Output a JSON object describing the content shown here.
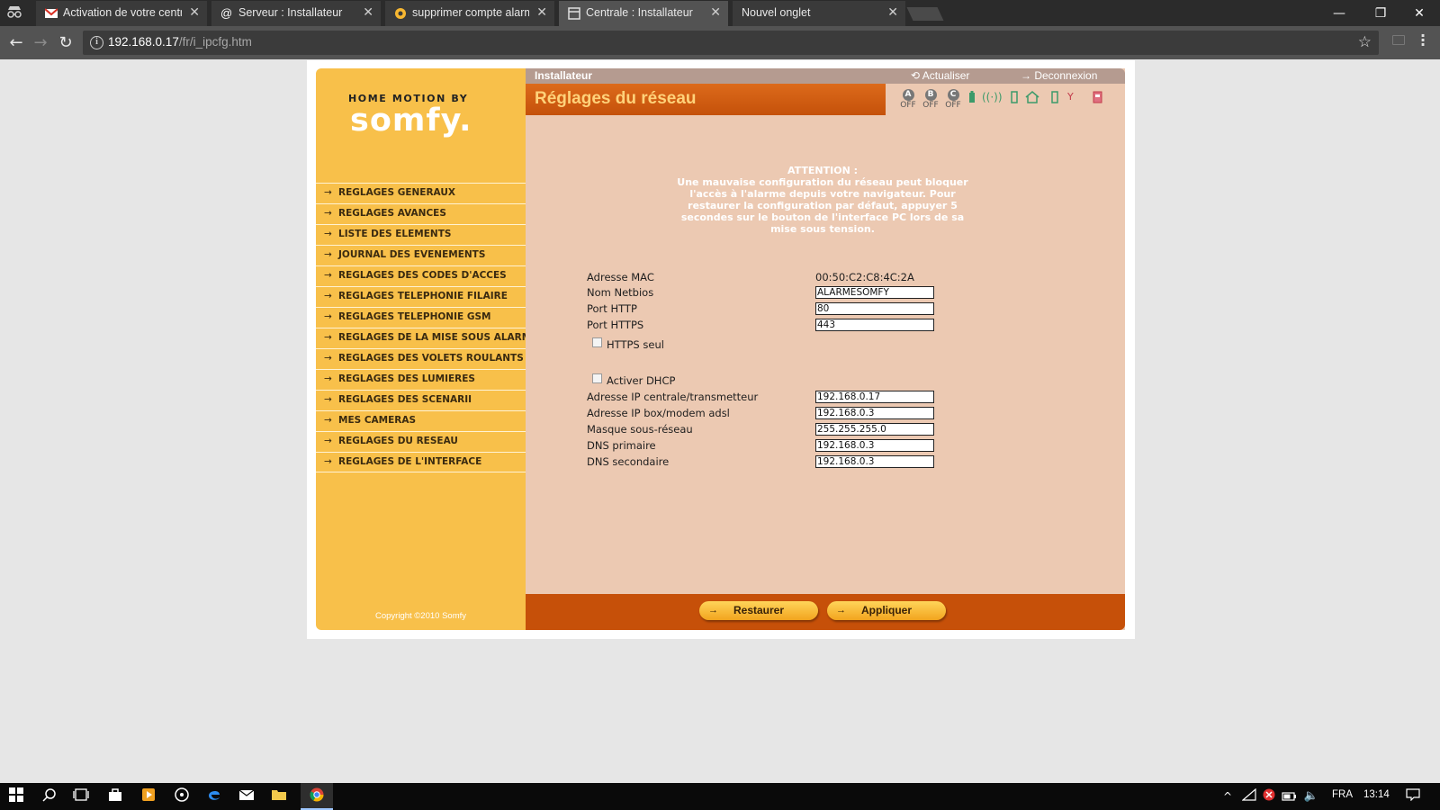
{
  "browser": {
    "tabs": [
      {
        "title": "Activation de votre centr",
        "icon": "gmail-icon"
      },
      {
        "title": "Serveur : Installateur",
        "icon": "at-icon"
      },
      {
        "title": "supprimer compte alarm",
        "icon": "circle-icon"
      },
      {
        "title": "Centrale : Installateur",
        "icon": "page-icon"
      },
      {
        "title": "Nouvel onglet",
        "icon": ""
      }
    ],
    "active_tab": 3,
    "url_host": "192.168.0.17",
    "url_path": "/fr/i_ipcfg.htm"
  },
  "brand": {
    "line1": "HOME MOTION BY",
    "line2": "somfy."
  },
  "sidebar": {
    "items": [
      {
        "label": "REGLAGES GENERAUX"
      },
      {
        "label": "REGLAGES AVANCES"
      },
      {
        "label": "LISTE DES ELEMENTS"
      },
      {
        "label": "JOURNAL DES EVENEMENTS"
      },
      {
        "label": "REGLAGES DES CODES D'ACCES"
      },
      {
        "label": "REGLAGES TELEPHONIE FILAIRE"
      },
      {
        "label": "REGLAGES TELEPHONIE GSM"
      },
      {
        "label": "REGLAGES DE LA MISE SOUS ALARME"
      },
      {
        "label": "REGLAGES DES VOLETS ROULANTS"
      },
      {
        "label": "REGLAGES DES LUMIERES"
      },
      {
        "label": "REGLAGES DES SCENARII"
      },
      {
        "label": "MES CAMERAS"
      },
      {
        "label": "REGLAGES DU RESEAU"
      },
      {
        "label": "REGLAGES DE L'INTERFACE"
      }
    ],
    "copyright": "Copyright ©2010 Somfy"
  },
  "header": {
    "role": "Installateur",
    "refresh": "Actualiser",
    "logout": "Deconnexion",
    "title": "Réglages du réseau",
    "zones": [
      {
        "letter": "A",
        "state": "OFF"
      },
      {
        "letter": "B",
        "state": "OFF"
      },
      {
        "letter": "C",
        "state": "OFF"
      }
    ]
  },
  "warning": {
    "title": "ATTENTION :",
    "body": "Une mauvaise configuration du réseau peut bloquer l'accès à l'alarme depuis votre navigateur. Pour restaurer la configuration par défaut, appuyer 5 secondes sur le bouton de l'interface PC lors de sa mise sous tension."
  },
  "form": {
    "mac_label": "Adresse MAC",
    "mac_value": "00:50:C2:C8:4C:2A",
    "netbios_label": "Nom Netbios",
    "netbios_value": "ALARMESOMFY",
    "http_label": "Port HTTP",
    "http_value": "80",
    "https_label": "Port HTTPS",
    "https_value": "443",
    "https_only_label": "HTTPS seul",
    "dhcp_label": "Activer DHCP",
    "ip_label": "Adresse IP centrale/transmetteur",
    "ip_value": "192.168.0.17",
    "gateway_label": "Adresse IP box/modem adsl",
    "gateway_value": "192.168.0.3",
    "mask_label": "Masque sous-réseau",
    "mask_value": "255.255.255.0",
    "dns1_label": "DNS primaire",
    "dns1_value": "192.168.0.3",
    "dns2_label": "DNS secondaire",
    "dns2_value": "192.168.0.3"
  },
  "footer": {
    "restore": "Restaurer",
    "apply": "Appliquer"
  },
  "taskbar": {
    "lang": "FRA",
    "clock": "13:14"
  }
}
